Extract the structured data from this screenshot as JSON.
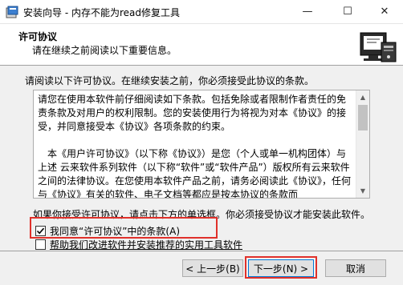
{
  "window": {
    "title": "安装向导 - 内存不能为read修复工具",
    "min_glyph": "—",
    "max_glyph": "☐",
    "close_glyph": "✕"
  },
  "header": {
    "title": "许可协议",
    "subtitle": "请在继续之前阅读以下重要信息。"
  },
  "main": {
    "instruction": "请阅读以下许可协议。在继续安装之前，你必须接受此协议的条款。",
    "license_text": "请您在使用本软件前仔细阅读如下条款。包括免除或者限制作者责任的免责条款及对用户的权利限制。您的安装使用行为将视为对本《协议》的接受，并同意接受本《协议》各项条款的约束。\n\n　本《用户许可协议》（以下称《协议》）是您（个人或单一机构团体）与上述 云来软件系列软件（以下称“软件”或“软件产品”）版权所有云来软件 之间的法律协议。在您使用本软件产品之前，请务必阅读此《协议》，任何与《协议》有关的软件、电子文档等都应是按本协议的条款而",
    "bottom_instruction": "如果你接受许可协议，请点击下方的单选框。你必须接受协议才能安装此软件。",
    "agree_label": "我同意“许可协议”中的条款(A)",
    "agree_checked": true,
    "help_label": "帮助我们改进软件并安装推荐的实用工具软件",
    "help_checked": false
  },
  "buttons": {
    "back": "< 上一步(B)",
    "next": "下一步(N) >",
    "cancel": "取消"
  },
  "colors": {
    "highlight": "#e0302a",
    "default_button_border": "#0078d7"
  }
}
